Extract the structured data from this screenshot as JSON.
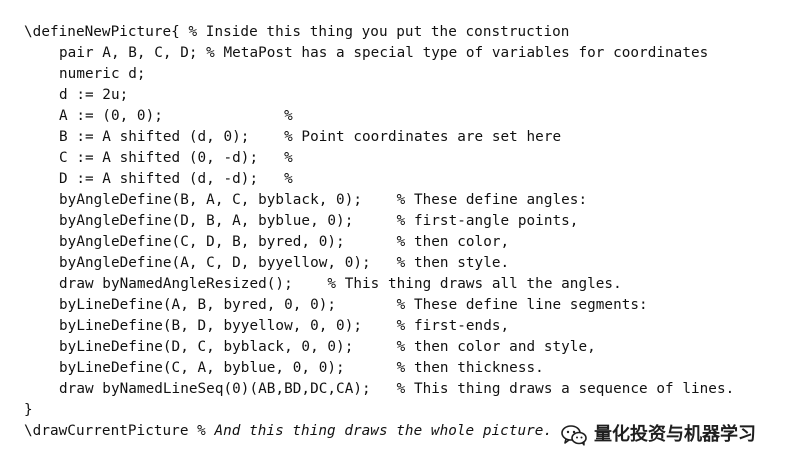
{
  "code": {
    "lines": [
      "\\defineNewPicture{ % Inside this thing you put the construction",
      "pair A, B, C, D; % MetaPost has a special type of variables for coordinates",
      "numeric d;",
      "d := 2u;",
      "A := (0, 0);              %",
      "B := A shifted (d, 0);    % Point coordinates are set here",
      "C := A shifted (0, -d);   %",
      "D := A shifted (d, -d);   %",
      "byAngleDefine(B, A, C, byblack, 0);    % These define angles:",
      "byAngleDefine(D, B, A, byblue, 0);     % first-angle points,",
      "byAngleDefine(C, D, B, byred, 0);      % then color,",
      "byAngleDefine(A, C, D, byyellow, 0);   % then style.",
      "draw byNamedAngleResized();    % This thing draws all the angles.",
      "byLineDefine(A, B, byred, 0, 0);       % These define line segments:",
      "byLineDefine(B, D, byyellow, 0, 0);    % first-ends,",
      "byLineDefine(D, C, byblack, 0, 0);     % then color and style,",
      "byLineDefine(C, A, byblue, 0, 0);      % then thickness.",
      "draw byNamedLineSeq(0)(AB,BD,DC,CA);   % This thing draws a sequence of lines.",
      "}"
    ],
    "last_line_code": "\\drawCurrentPicture ",
    "last_line_comment": "% And this thing draws the whole picture."
  },
  "watermark": {
    "icon": "wechat-icon",
    "text": "量化投资与机器学习"
  }
}
